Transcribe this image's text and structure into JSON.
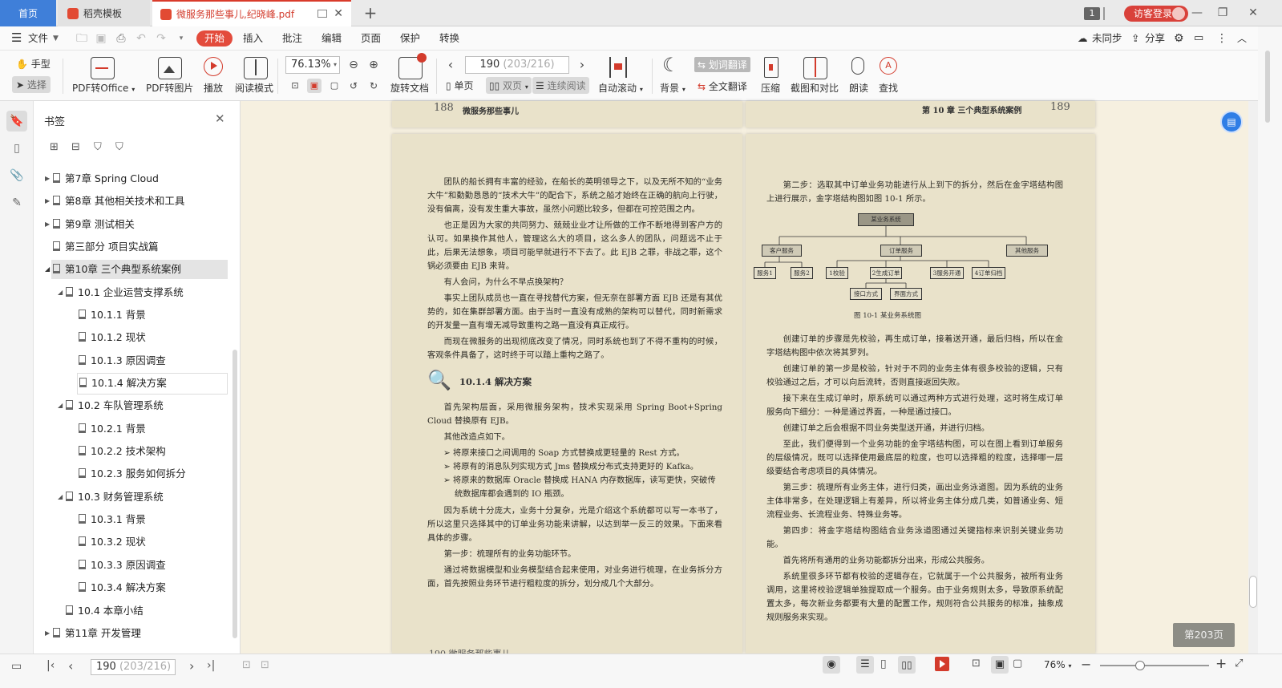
{
  "titlebar": {
    "tab_home": "首页",
    "tab_template": "稻壳模板",
    "tab_pdf": "微服务那些事儿,纪晓峰.pdf",
    "badge": "1",
    "login": "访客登录"
  },
  "menu": {
    "file": "文件",
    "items": [
      "开始",
      "插入",
      "批注",
      "编辑",
      "页面",
      "保护",
      "转换"
    ],
    "sync": "未同步",
    "share": "分享"
  },
  "toolbar": {
    "hand": "手型",
    "select": "选择",
    "pdf_to_office": "PDF转Office",
    "pdf_to_image": "PDF转图片",
    "play": "播放",
    "read_mode": "阅读模式",
    "zoom": "76.13%",
    "rotate": "旋转文档",
    "page_current": "190",
    "page_total": "(203/216)",
    "single": "单页",
    "double": "双页",
    "continuous": "连续阅读",
    "autoscroll": "自动滚动",
    "background": "背景",
    "word_translate": "划词翻译",
    "full_translate": "全文翻译",
    "compress": "压缩",
    "screenshot_compare": "截图和对比",
    "read_aloud": "朗读",
    "find": "查找"
  },
  "bookmarks": {
    "title": "书签",
    "items": [
      "第7章 Spring Cloud",
      "第8章 其他相关技术和工具",
      "第9章 测试相关",
      "第三部分 项目实战篇",
      "第10章 三个典型系统案例",
      "10.1 企业运营支撑系统",
      "10.1.1 背景",
      "10.1.2 现状",
      "10.1.3 原因调查",
      "10.1.4 解决方案",
      "10.2 车队管理系统",
      "10.2.1 背景",
      "10.2.2 技术架构",
      "10.2.3 服务如何拆分",
      "10.3 财务管理系统",
      "10.3.1 背景",
      "10.3.2 现状",
      "10.3.3 原因调查",
      "10.3.4 解决方案",
      "10.4 本章小结",
      "第11章 开发管理"
    ]
  },
  "doc": {
    "left_header_num": "188",
    "left_header_title": "微服务那些事儿",
    "right_header_title": "第 10 章 三个典型系统案例",
    "right_header_num": "189",
    "left_paragraphs": [
      "团队的船长拥有丰富的经验，在船长的英明领导之下，以及无所不知的“业务大牛”和勤勤恳恳的“技术大牛”的配合下，系统之船才始终在正确的航向上行驶，没有偏离，没有发生重大事故，虽然小问题比较多，但都在可控范围之内。",
      "也正是因为大家的共同努力、兢兢业业才让所做的工作不断地得到客户方的认可。如果换作其他人，管理这么大的项目，这么多人的团队，问题远不止于此，后果无法想象，项目可能早就进行不下去了。此 EJB 之罪，非战之罪，这个锅必须要由 EJB 来背。",
      "有人会问，为什么不早点换架构？",
      "事实上团队成员也一直在寻找替代方案，但无奈在部署方面 EJB 还是有其优势的，如在集群部署方面。由于当时一直没有成熟的架构可以替代，同时新需求的开发量一直有增无减导致重构之路一直没有真正成行。",
      "而现在微服务的出现彻底改变了情况，同时系统也到了不得不重构的时候，客观条件具备了，这时终于可以踏上重构之路了。"
    ],
    "section_title": "10.1.4 解决方案",
    "left_paragraphs_2": [
      "首先架构层面，采用微服务架构，技术实现采用 Spring Boot+Spring Cloud 替换原有 EJB。",
      "其他改造点如下。"
    ],
    "bullets": [
      "将原来接口之间调用的 Soap 方式替换成更轻量的 Rest 方式。",
      "将原有的消息队列实现方式 Jms 替换成分布式支持更好的 Kafka。",
      "将原来的数据库 Oracle 替换成 HANA 内存数据库，读写更快，突破传统数据库都会遇到的 IO 瓶颈。"
    ],
    "left_paragraphs_3": [
      "因为系统十分庞大，业务十分复杂，光是介绍这个系统都可以写一本书了，所以这里只选择其中的订单业务功能来讲解，以达到举一反三的效果。下面来看具体的步骤。",
      "第一步：梳理所有的业务功能环节。",
      "通过将数据模型和业务模型结合起来使用，对业务进行梳理，在业务拆分方面，首先按照业务环节进行粗粒度的拆分，划分成几个大部分。"
    ],
    "left_footer": "190 微服务那些事儿",
    "right_paragraphs_1": [
      "第二步：选取其中订单业务功能进行从上到下的拆分，然后在金字塔结构图上进行展示，金字塔结构图如图 10-1 所示。"
    ],
    "diagram": {
      "root": "某业务系统",
      "level1": [
        "客户服务",
        "订单服务",
        "其他服务"
      ],
      "level2": [
        "服务1",
        "服务2",
        "1校验",
        "2生成订单",
        "3服务开通",
        "4订单归档"
      ],
      "level3": [
        "接口方式",
        "界面方式"
      ],
      "caption": "图 10-1 某业务系统图"
    },
    "right_paragraphs_2": [
      "创建订单的步骤是先校验，再生成订单，接着送开通，最后归档，所以在金字塔结构图中依次将其罗列。",
      "创建订单的第一步是校验，针对于不同的业务主体有很多校验的逻辑，只有校验通过之后，才可以向后流转，否则直接返回失败。",
      "接下来在生成订单时，原系统可以通过两种方式进行处理，这时将生成订单服务向下细分：一种是通过界面，一种是通过接口。",
      "创建订单之后会根据不同业务类型送开通，并进行归档。",
      "至此，我们便得到一个业务功能的金字塔结构图，可以在图上看到订单服务的层级情况，既可以选择使用最底层的粒度，也可以选择粗的粒度，选择哪一层级要结合考虑项目的具体情况。",
      "第三步：梳理所有业务主体，进行归类，画出业务泳道图。因为系统的业务主体非常多，在处理逻辑上有差异，所以将业务主体分成几类，如普通业务、短流程业务、长流程业务、特殊业务等。",
      "第四步：将金字塔结构图结合业务泳道图通过关键指标来识别关键业务功能。",
      "首先将所有通用的业务功能都拆分出来，形成公共服务。",
      "系统里很多环节都有校验的逻辑存在，它就属于一个公共服务，被所有业务调用，这里将校验逻辑单独提取成一个服务。由于业务规则太多，导致原系统配置太多，每次新业务都要有大量的配置工作，规则符合公共服务的标准，抽象成规则服务来实现。"
    ],
    "page_badge": "第203页"
  },
  "status": {
    "page_current": "190",
    "page_total": "(203/216)",
    "zoom": "76%"
  },
  "colors": {
    "accent_red": "#e34b3c",
    "home_blue": "#3f7fd9",
    "page_bg": "#e9e2ca"
  }
}
